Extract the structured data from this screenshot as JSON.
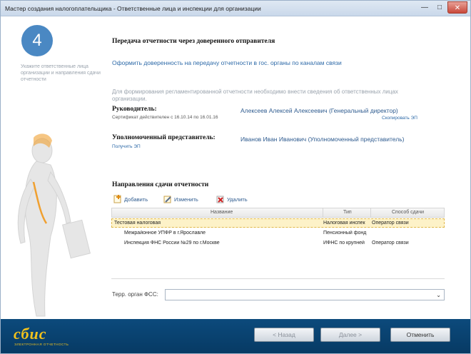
{
  "window": {
    "title": "Мастер создания налогоплательщика - Ответственные лица и инспекции для организации",
    "minimize_glyph": "—",
    "maximize_glyph": "□",
    "close_glyph": "✕"
  },
  "sidebar": {
    "step_number": "4",
    "step_hint": "Укажите ответственные лица организации и направления сдачи отчетности"
  },
  "section_proxy": {
    "title": "Передача отчетности через доверенного отправителя",
    "link": "Оформить доверенность на передачу отчетности в гос. органы по каналам связи"
  },
  "info_text": "Для формирования регламентированной отчетности необходимо внести сведения об ответственных лицах организации.",
  "director": {
    "label": "Руководитель:",
    "certificate": "Сертификат действителен с 16.10.14 по 16.01.16",
    "value": "Алексеев Алексей Алексеевич (Генеральный директор)",
    "copy_link": "Скопировать ЭП"
  },
  "representative": {
    "label": "Уполномоченный представитель:",
    "value": "Иванов Иван Иванович (Уполномоченный представитель)",
    "get_link": "Получить ЭП"
  },
  "directions": {
    "title": "Направления сдачи отчетности",
    "toolbar": {
      "add": "Добавить",
      "edit": "Изменить",
      "delete": "Удалить"
    },
    "columns": [
      "Название",
      "Тип",
      "Способ сдачи"
    ],
    "rows": [
      {
        "name": "Тестовая налоговая",
        "type": "Налоговая инспек",
        "method": "Оператор связи"
      },
      {
        "name": "Межрайонное УПФР в г.Ярославле",
        "type": "Пенсионный фонд",
        "method": ""
      },
      {
        "name": "Инспекция ФНС России №29 по г.Москве",
        "type": "ИФНС по крупней",
        "method": "Оператор связи"
      }
    ]
  },
  "fss": {
    "label": "Терр. орган ФСС:",
    "value": ""
  },
  "footer": {
    "logo": "сбис",
    "logo_sub": "ЭЛЕКТРОННАЯ ОТЧЕТНОСТЬ",
    "back": "< Назад",
    "next": "Далее >",
    "cancel": "Отменить"
  },
  "colors": {
    "accent": "#4a88c3",
    "bottom_bar": "#0a4472",
    "logo": "#f2c21c",
    "selected_row": "#fdf2c8"
  }
}
